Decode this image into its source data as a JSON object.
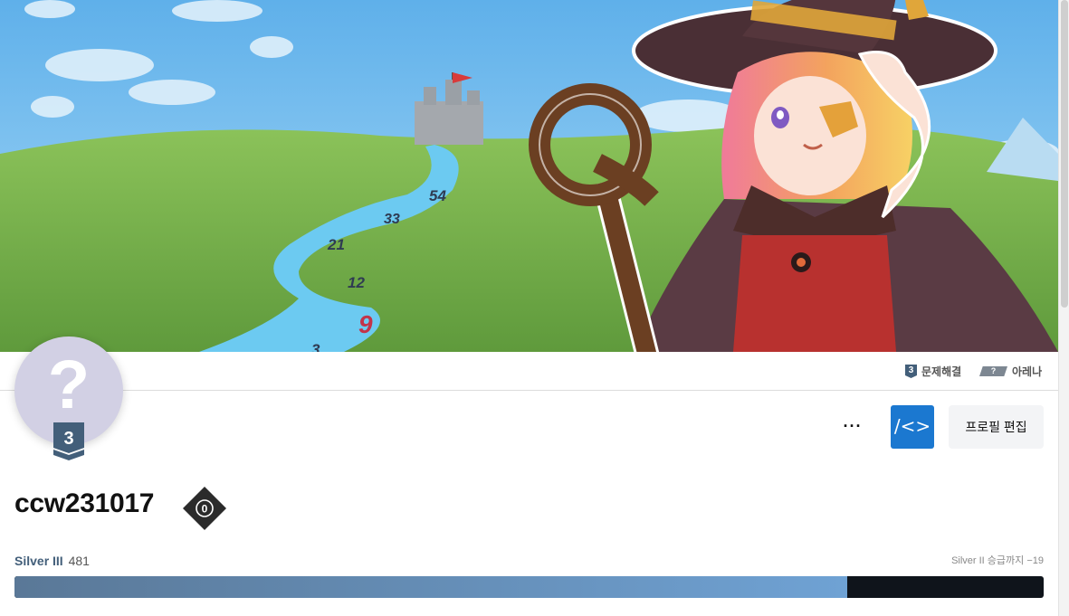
{
  "tabs": {
    "solved": {
      "icon_text": "3",
      "label": "문제해결"
    },
    "arena": {
      "icon_text": "?",
      "label": "아레나"
    }
  },
  "avatar": {
    "placeholder": "?",
    "tier_number": "3",
    "tier_color": "#435f7a"
  },
  "actions": {
    "more_label": "···",
    "code_label": "/<>",
    "edit_label": "프로필 편집",
    "code_color": "#1b78d0"
  },
  "profile": {
    "username": "ccw231017",
    "class_badge_text": "0"
  },
  "rating": {
    "tier_name": "Silver III",
    "value": "481",
    "next_tier_text": "Silver II 승급까지 −19",
    "progress_fraction": 0.809,
    "fill_color": "#6fa2d4"
  },
  "banner": {
    "sign_numbers": [
      "54",
      "33",
      "21",
      "12",
      "9",
      "3"
    ]
  }
}
